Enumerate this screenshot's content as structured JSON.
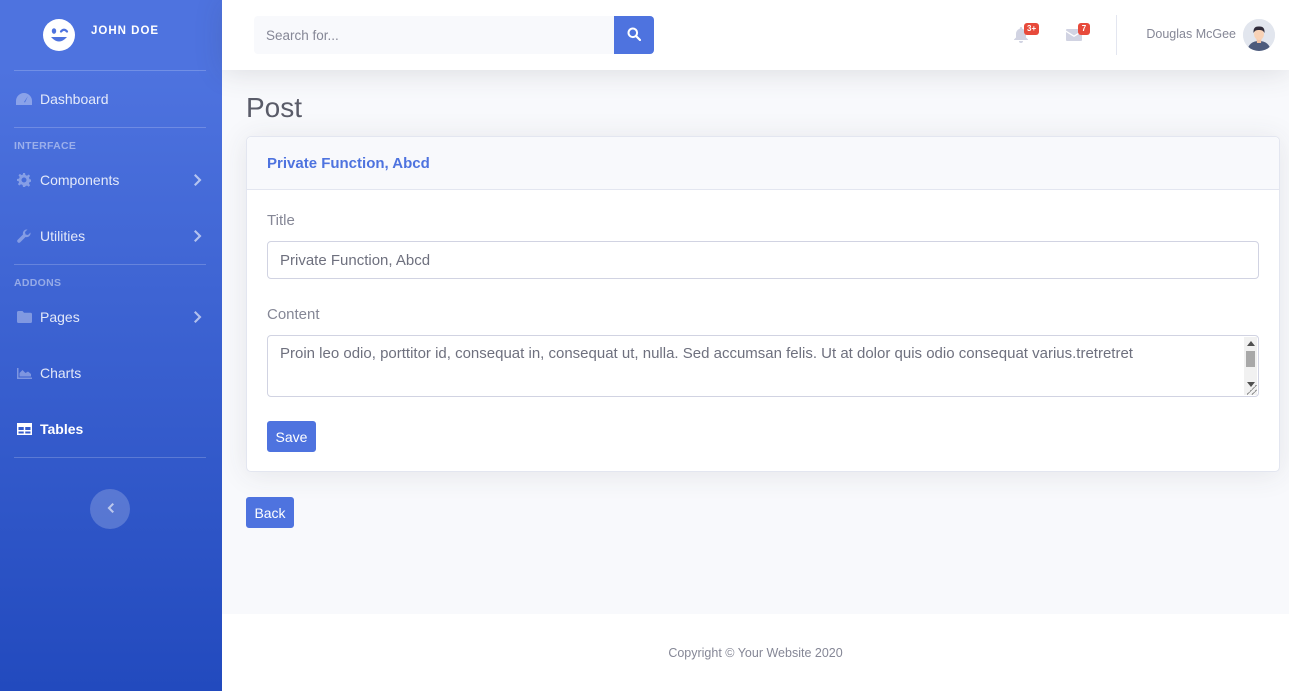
{
  "brand": {
    "name": "JOHN DOE",
    "icon": "laugh-wink-icon"
  },
  "sidebar": {
    "dashboard": {
      "label": "Dashboard",
      "icon": "tachometer-icon"
    },
    "heading_interface": "INTERFACE",
    "components": {
      "label": "Components",
      "icon": "cog-icon"
    },
    "utilities": {
      "label": "Utilities",
      "icon": "wrench-icon"
    },
    "heading_addons": "ADDONS",
    "pages": {
      "label": "Pages",
      "icon": "folder-icon"
    },
    "charts": {
      "label": "Charts",
      "icon": "chart-area-icon"
    },
    "tables": {
      "label": "Tables",
      "icon": "table-icon"
    }
  },
  "topbar": {
    "search_placeholder": "Search for...",
    "alerts_badge": "3+",
    "messages_badge": "7",
    "user_name": "Douglas McGee"
  },
  "page": {
    "title": "Post",
    "card_header": "Private Function, Abcd",
    "title_label": "Title",
    "title_value": "Private Function, Abcd",
    "content_label": "Content",
    "content_value": "Proin leo odio, porttitor id, consequat in, consequat ut, nulla. Sed accumsan felis. Ut at dolor quis odio consequat varius.tretretret",
    "save_label": "Save",
    "back_label": "Back"
  },
  "footer": {
    "copyright": "Copyright © Your Website 2020"
  },
  "colors": {
    "primary": "#4e73df",
    "danger": "#e74a3b",
    "sidebar_end": "#224abe"
  }
}
